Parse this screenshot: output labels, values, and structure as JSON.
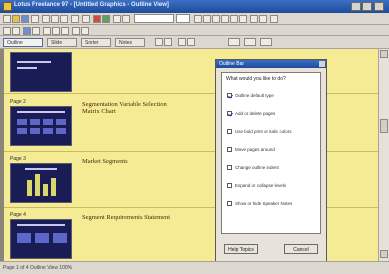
{
  "window": {
    "title": "Lotus Freelance 97 - [Untitled Graphics - Outline View]"
  },
  "toolbar": {
    "font_name": "Times New Roman",
    "font_size": "24"
  },
  "view_tabs": [
    "Outline",
    "Slide",
    "Sorter",
    "Notes"
  ],
  "slides": [
    {
      "number": "Page 1",
      "title": ""
    },
    {
      "number": "Page 2",
      "title": "Segmentation Variable Selection Matrix Chart"
    },
    {
      "number": "Page 3",
      "title": "Market Segments"
    },
    {
      "number": "Page 4",
      "title": "Segment Requirements Statement"
    }
  ],
  "panel": {
    "title": "Outline Bar",
    "header": "What would you like to do?",
    "options": [
      {
        "label": "Outline default type",
        "checked": true
      },
      {
        "label": "Add or delete pages",
        "checked": true
      },
      {
        "label": "Use bold print or italic colors",
        "checked": false
      },
      {
        "label": "Move pages around",
        "checked": false
      },
      {
        "label": "Change outline indent",
        "checked": false
      },
      {
        "label": "Expand or collapse levels",
        "checked": false
      },
      {
        "label": "Show or hide Speaker Notes",
        "checked": false
      }
    ],
    "ok_button": "Help Topics",
    "close_button": "Cancel"
  },
  "status": {
    "text": "Page 1 of 4   Outline View   100%"
  },
  "colors": {
    "background": "#f5eb95",
    "thumb": "#1a1c56",
    "title": "#4a2a0c"
  }
}
